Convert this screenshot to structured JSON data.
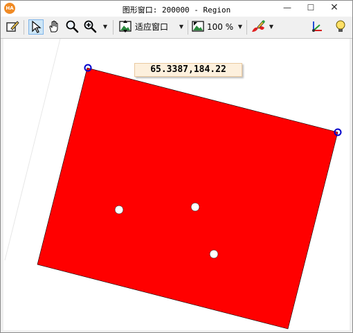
{
  "window": {
    "app_icon_text": "HA",
    "title": "图形窗口: 200000 - Region",
    "minimize_glyph": "—",
    "maximize_glyph": "☐",
    "close_glyph": "✕"
  },
  "toolbar": {
    "zoom_mode_label": "适应窗口",
    "zoom_percent_label": "100 %",
    "dropdown_glyph": "▼"
  },
  "canvas": {
    "coordinate_readout": "65.3387,184.22",
    "region_color": "#ff0000",
    "handle_color": "#0000cc"
  }
}
